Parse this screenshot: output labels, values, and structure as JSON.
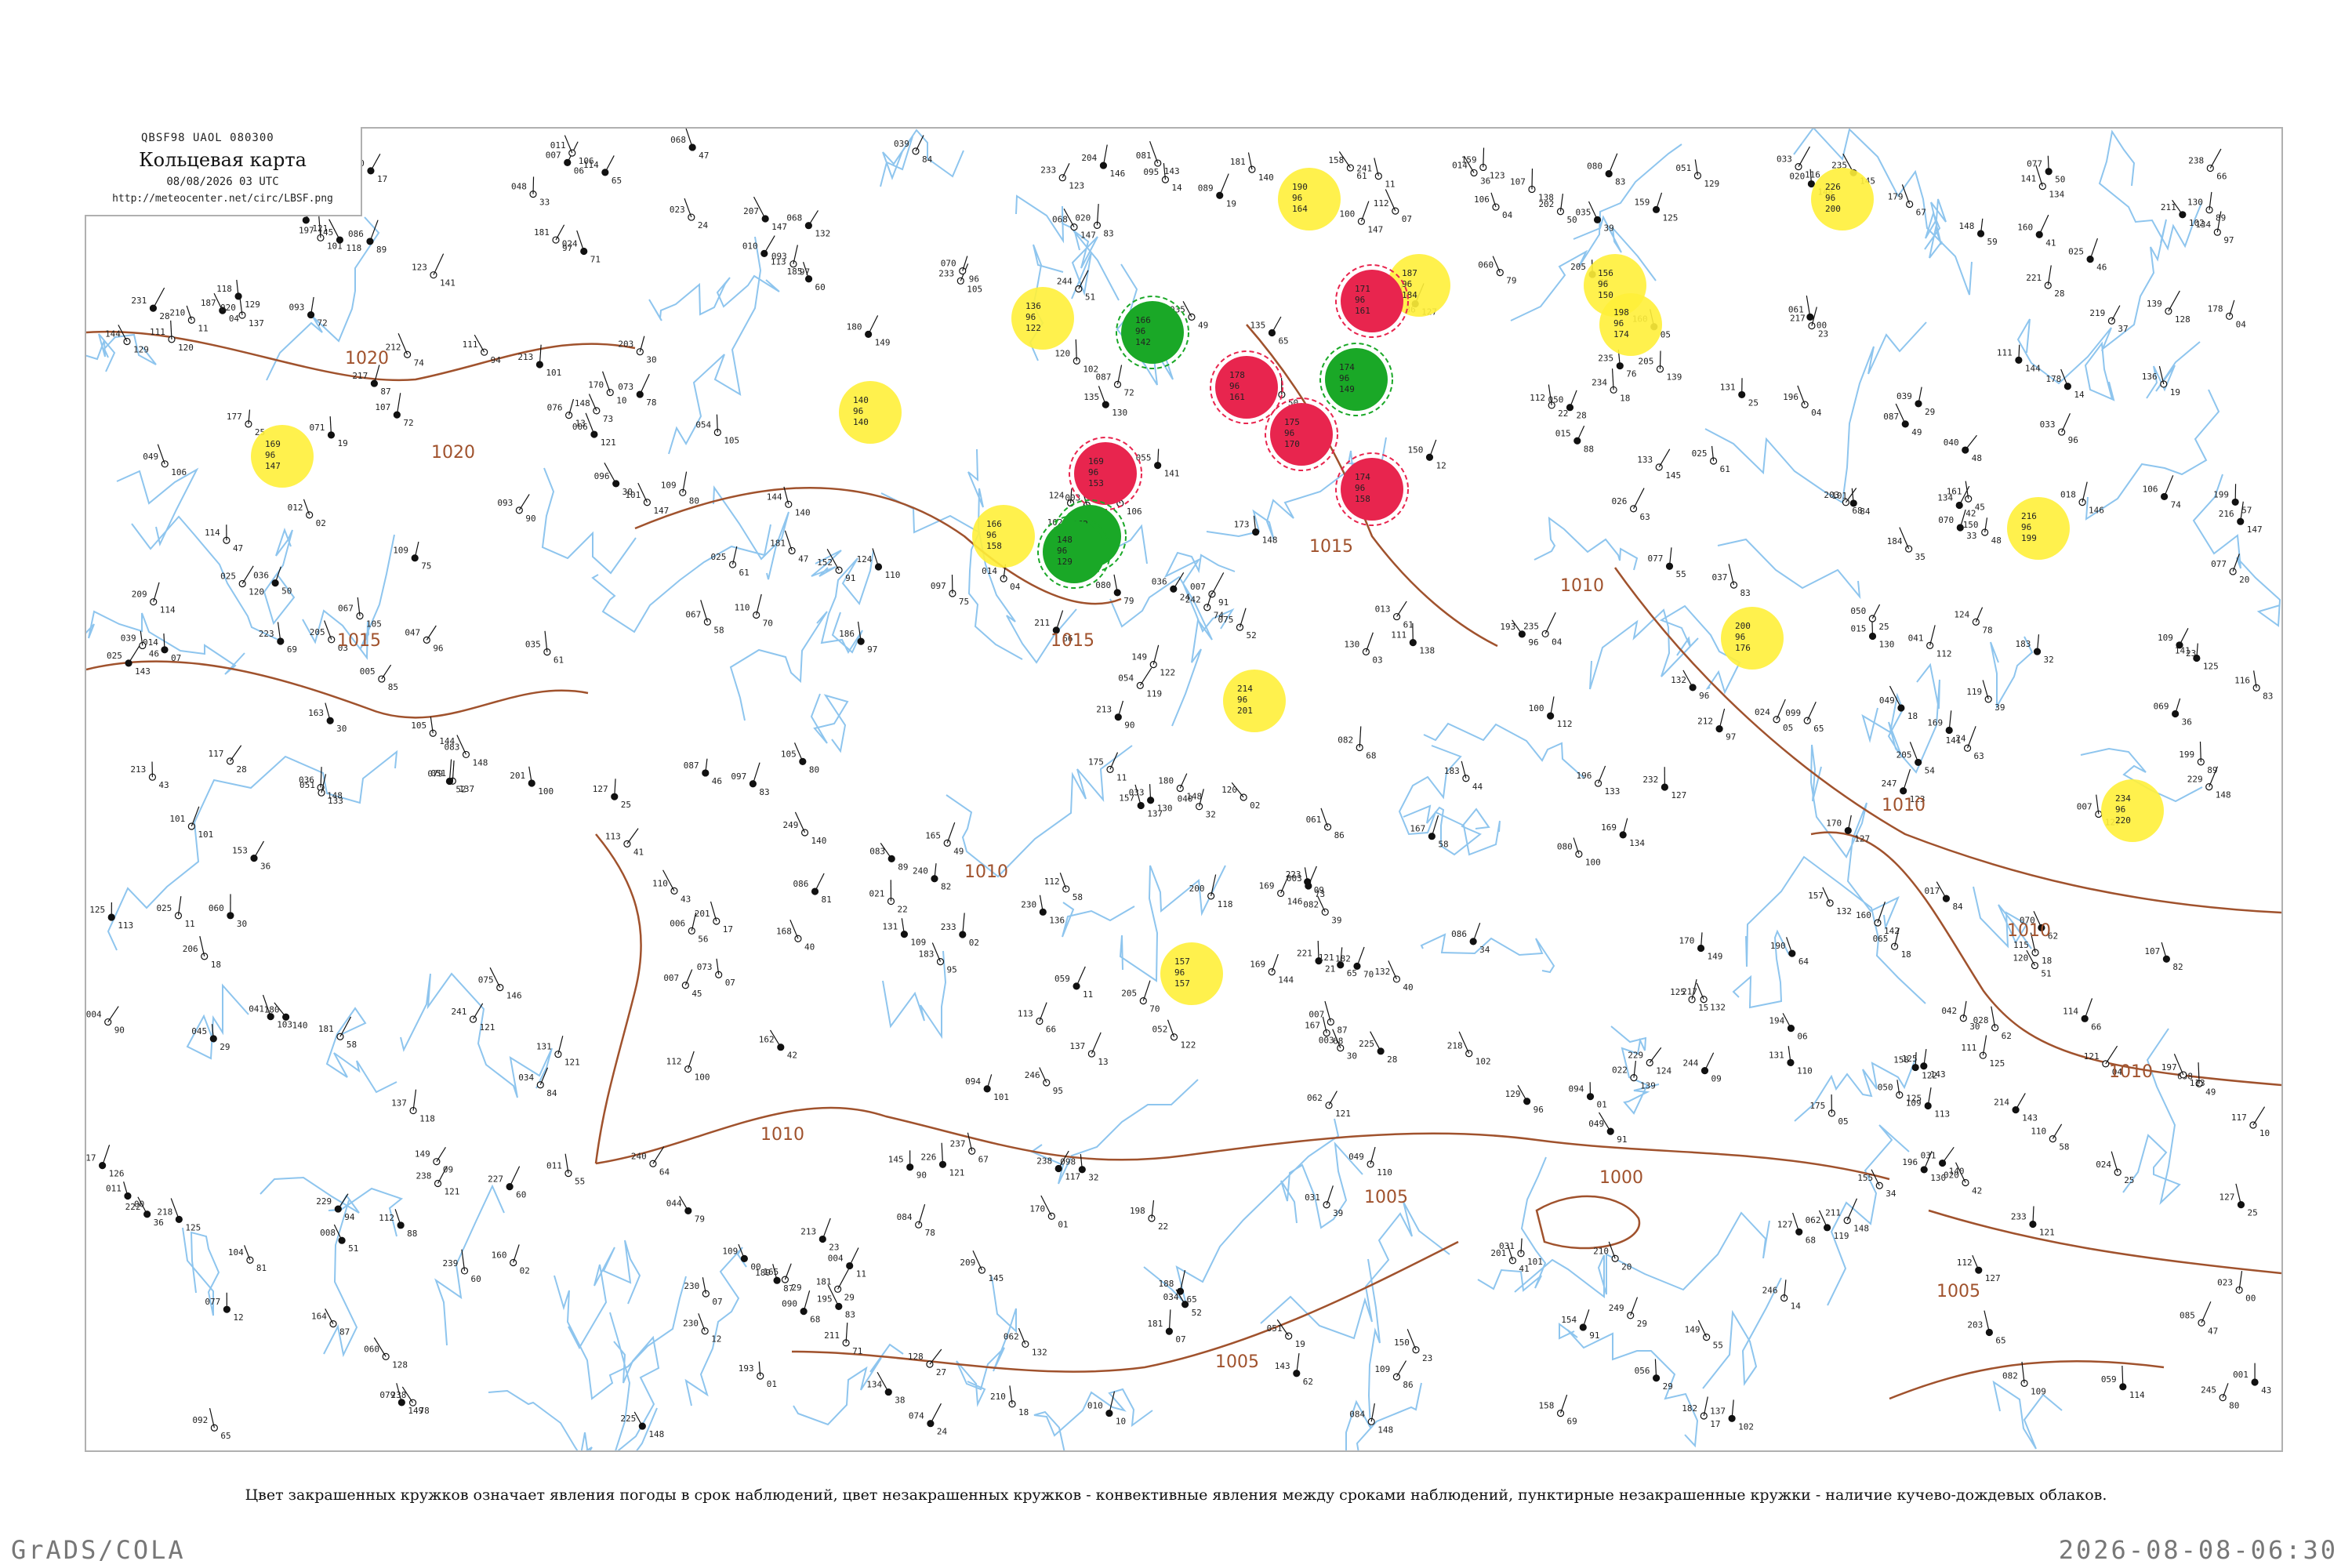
{
  "header": {
    "code_line": "QBSF98  UAOL  080300",
    "title": "Кольцевая карта",
    "time": "08/08/2026 03 UTC",
    "url": "http://meteocenter.net/circ/LBSF.png"
  },
  "legend_note": "Цвет закрашенных кружков означает явления погоды в срок наблюдений, цвет незакрашенных кружков - конвективные явления между сроками наблюдений, пунктирные незакрашенные кружки - наличие кучево-дождевых облаков.",
  "footer": {
    "left": "GrADS/COLA",
    "right": "2026-08-08-06:30"
  },
  "isobar_labels": [
    "1020",
    "1020",
    "1015",
    "1015",
    "1015",
    "1010",
    "1010",
    "1010",
    "1010",
    "1010",
    "1010",
    "1005",
    "1005",
    "1005",
    "1000"
  ],
  "colors": {
    "isobar": "#a0522d",
    "river": "#8ec5ee",
    "yellow_marker": "#ffef3a",
    "red_marker": "#e8254e",
    "green_marker": "#1aa827",
    "frame": "#b0b0b0"
  },
  "markers": {
    "yellow": [
      {
        "t": "169 96 147"
      },
      {
        "t": "140 96 140"
      },
      {
        "t": "136 96 122"
      },
      {
        "t": "166 96 158"
      },
      {
        "t": "157 96 157"
      },
      {
        "t": "214 96 201"
      },
      {
        "t": "190 96 164"
      },
      {
        "t": "156 96 150"
      },
      {
        "t": "187 96 184"
      },
      {
        "t": "198 96 174"
      },
      {
        "t": "200 96 176"
      },
      {
        "t": "216 96 199"
      },
      {
        "t": "234 96 220"
      },
      {
        "t": "226 96 200"
      }
    ],
    "red": [
      {
        "t": "171 96 161"
      },
      {
        "t": "169 96 153"
      },
      {
        "t": "178 96 161"
      },
      {
        "t": "175 96 170"
      },
      {
        "t": "174 96 158"
      }
    ],
    "green": [
      {
        "t": "166 96 142"
      },
      {
        "t": "174 96 149"
      },
      {
        "t": "162 96 143"
      },
      {
        "t": "148 96 129"
      }
    ]
  }
}
